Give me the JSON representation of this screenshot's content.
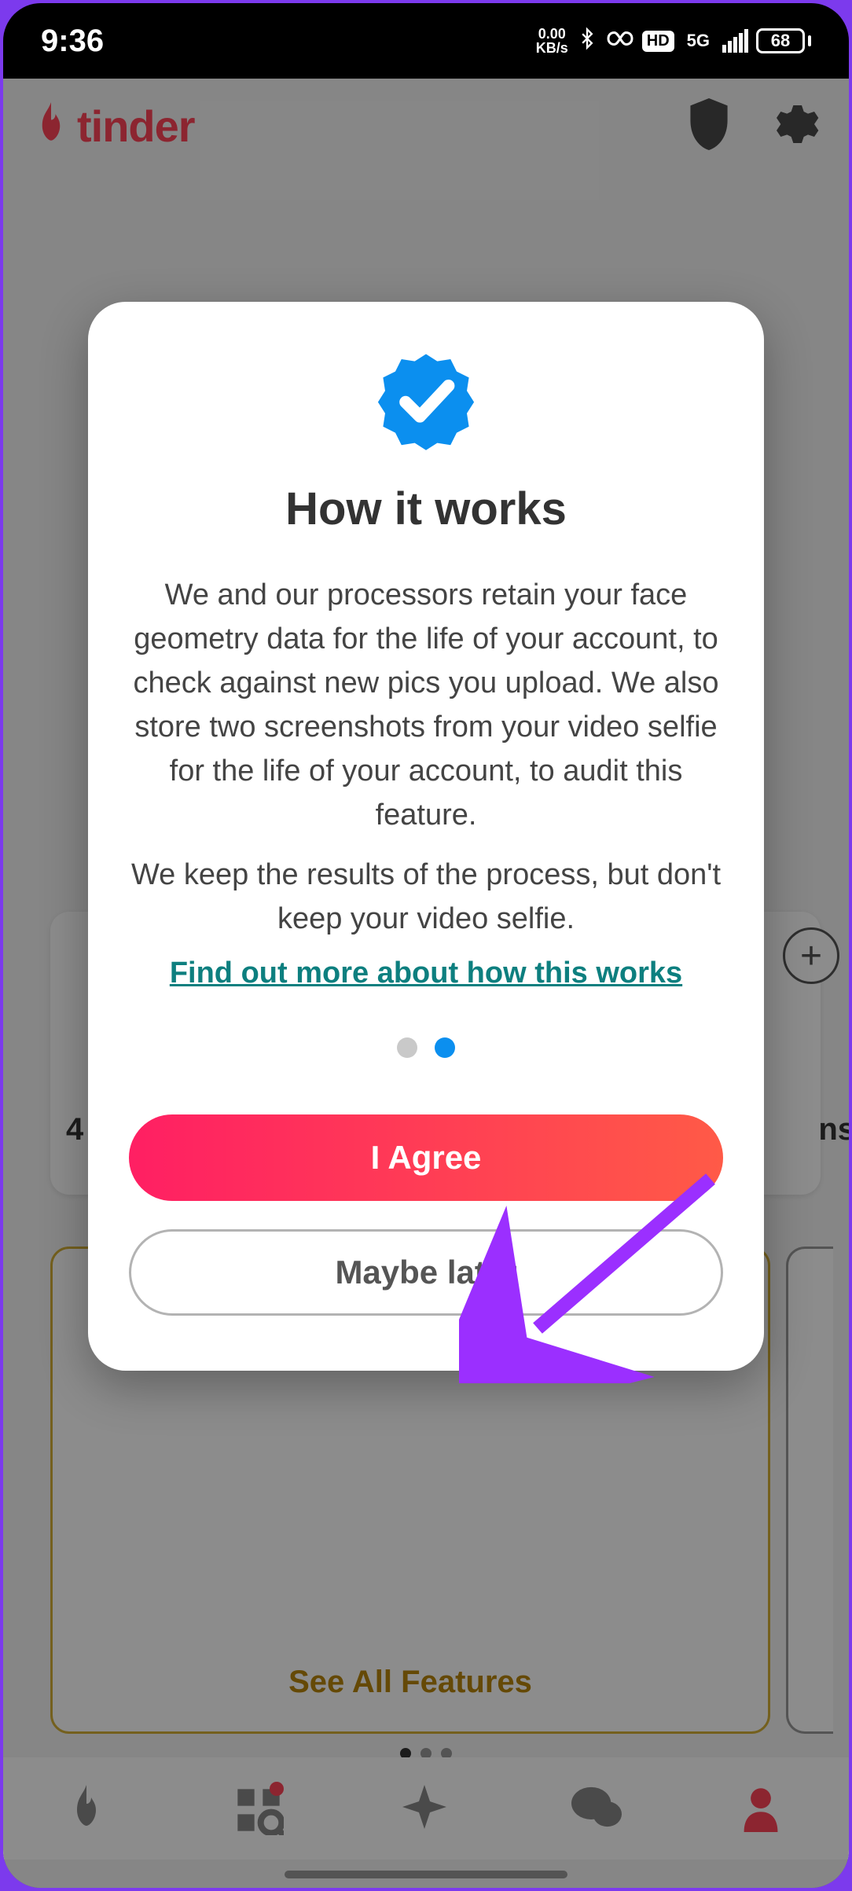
{
  "status_bar": {
    "time": "9:36",
    "net_rate_top": "0.00",
    "net_rate_bottom": "KB/s",
    "hd": "HD",
    "fiveg": "5G",
    "battery": "68"
  },
  "header": {
    "brand": "tinder"
  },
  "background": {
    "card_left_text": "4",
    "card_right_text": "ns",
    "see_all": "See All Features"
  },
  "modal": {
    "title": "How it works",
    "body_line1": "We and our processors retain your face geometry data for the life of your account, to check against new pics you upload. We also store two screenshots from your video selfie for the life of your account, to audit this feature.",
    "body_line2": "We keep the results of the process, but don't keep your video selfie.",
    "link": "Find out more about how this works",
    "agree": "I Agree",
    "later": "Maybe later"
  }
}
